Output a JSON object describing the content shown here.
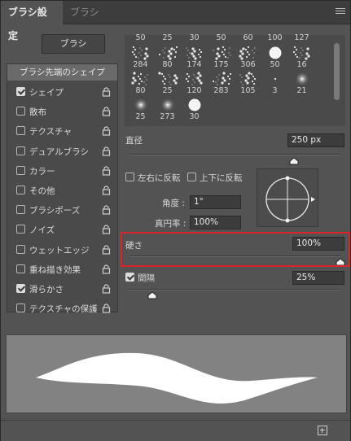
{
  "tabs": [
    {
      "label": "ブラシ設定",
      "active": true
    },
    {
      "label": "ブラシ",
      "active": false
    }
  ],
  "brush_button": "ブラシ",
  "tip_shape_label": "ブラシ先端のシェイプ",
  "options": [
    {
      "label": "シェイプ",
      "checked": true
    },
    {
      "label": "散布",
      "checked": false
    },
    {
      "label": "テクスチャ",
      "checked": false
    },
    {
      "label": "デュアルブラシ",
      "checked": false
    },
    {
      "label": "カラー",
      "checked": false
    },
    {
      "label": "その他",
      "checked": false
    },
    {
      "label": "ブラシポーズ",
      "checked": false
    },
    {
      "label": "ノイズ",
      "checked": false
    },
    {
      "label": "ウェットエッジ",
      "checked": false
    },
    {
      "label": "重ね描き効果",
      "checked": false
    },
    {
      "label": "滑らかさ",
      "checked": true
    },
    {
      "label": "テクスチャの保護",
      "checked": false
    }
  ],
  "preset_rows": [
    [
      "50",
      "25",
      "30",
      "50",
      "60",
      "100",
      "127"
    ],
    [
      "284",
      "80",
      "174",
      "175",
      "306",
      "50",
      "16"
    ],
    [
      "80",
      "25",
      "120",
      "283",
      "105",
      "3",
      "21"
    ],
    [
      "25",
      "273",
      "30"
    ]
  ],
  "diameter": {
    "label": "直径",
    "value": "250 px"
  },
  "flip_x_label": "左右に反転",
  "flip_y_label": "上下に反転",
  "angle": {
    "label": "角度 :",
    "value": "1°"
  },
  "roundness": {
    "label": "真円率 :",
    "value": "100%"
  },
  "hardness": {
    "label": "硬さ",
    "value": "100%",
    "fraction": 1.0
  },
  "spacing": {
    "label": "間隔",
    "value": "25%",
    "checked": true
  },
  "colors": {
    "panel": "#535353",
    "highlight": "#d9252a"
  }
}
